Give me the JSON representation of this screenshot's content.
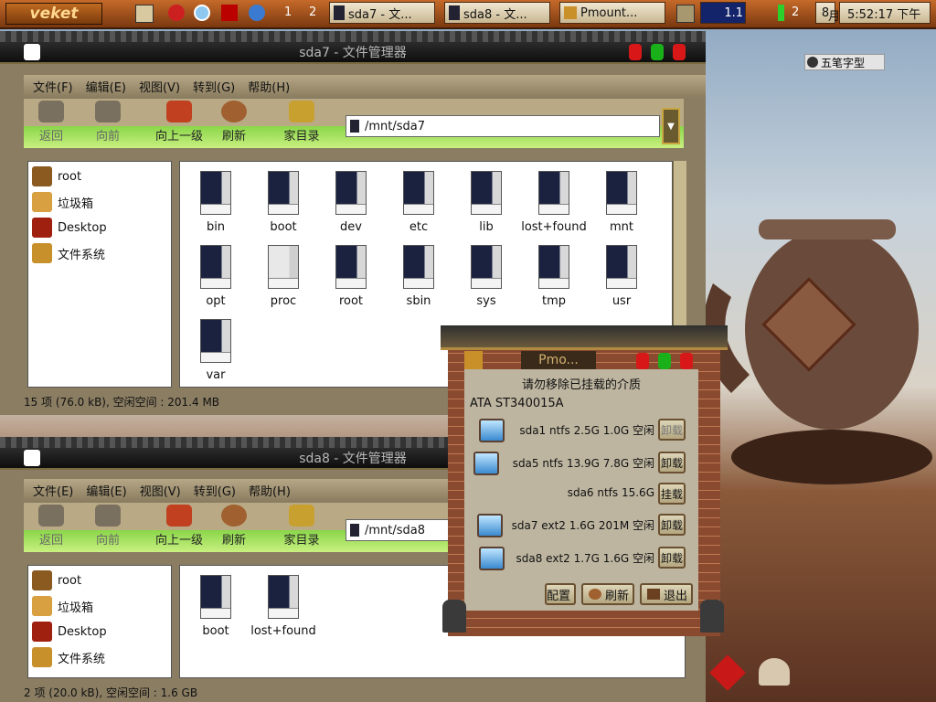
{
  "panel": {
    "logo": "veket",
    "workspaces": [
      "1",
      "2"
    ],
    "tasks": [
      {
        "label": "sda7 - 文..."
      },
      {
        "label": "sda8 - 文..."
      },
      {
        "label": "Pmount..."
      }
    ],
    "cpu_value": "1.1",
    "tray_number": "2",
    "date_day": "8",
    "date_suffix": "月",
    "clock": "5:52:17 下午"
  },
  "ime": {
    "label": "五笔字型"
  },
  "win1": {
    "title": "sda7 - 文件管理器",
    "menus": [
      "文件(F)",
      "编辑(E)",
      "视图(V)",
      "转到(G)",
      "帮助(H)"
    ],
    "toolbar": [
      "返回",
      "向前",
      "向上一级",
      "刷新",
      "家目录"
    ],
    "address": "/mnt/sda7",
    "sidebar": [
      "root",
      "垃圾箱",
      "Desktop",
      "文件系统"
    ],
    "files": [
      "bin",
      "boot",
      "dev",
      "etc",
      "lib",
      "lost+found",
      "mnt",
      "opt",
      "proc",
      "root",
      "sbin",
      "sys",
      "tmp",
      "usr",
      "var"
    ],
    "status": "15 项 (76.0 kB), 空闲空间 : 201.4 MB"
  },
  "win2": {
    "title": "sda8 - 文件管理器",
    "menus": [
      "文件(E)",
      "编辑(E)",
      "视图(V)",
      "转到(G)",
      "帮助(H)"
    ],
    "toolbar": [
      "返回",
      "向前",
      "向上一级",
      "刷新",
      "家目录"
    ],
    "address": "/mnt/sda8",
    "sidebar": [
      "root",
      "垃圾箱",
      "Desktop",
      "文件系统"
    ],
    "files": [
      "boot",
      "lost+found"
    ],
    "status": "2 项 (20.0 kB), 空闲空间 : 1.6 GB"
  },
  "pmount": {
    "title": "Pmo...",
    "warning": "请勿移除已挂载的介质",
    "device": "ATA ST340015A",
    "partitions": [
      {
        "text": "sda1 ntfs 2.5G 1.0G 空闲",
        "button": "卸载",
        "enabled": false
      },
      {
        "text": "sda5 ntfs 13.9G 7.8G 空闲",
        "button": "卸载",
        "enabled": true
      },
      {
        "text": "sda6 ntfs 15.6G",
        "button": "挂载",
        "enabled": true
      },
      {
        "text": "sda7 ext2 1.6G 201M 空闲",
        "button": "卸载",
        "enabled": true
      },
      {
        "text": "sda8 ext2 1.7G 1.6G 空闲",
        "button": "卸载",
        "enabled": true
      }
    ],
    "buttons": {
      "config": "配置",
      "refresh": "刷新",
      "quit": "退出"
    }
  }
}
